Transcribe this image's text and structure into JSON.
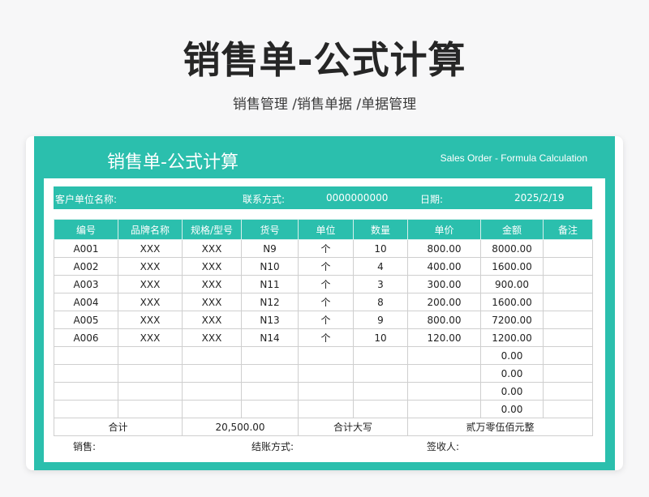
{
  "page": {
    "title": "销售单-公式计算",
    "breadcrumb": "销售管理 /销售单据 /单据管理"
  },
  "sheet": {
    "title": "销售单-公式计算",
    "subtitle": "Sales Order - Formula Calculation",
    "accent_color": "#2bbfad"
  },
  "info": {
    "customer_label": "客户单位名称:",
    "contact_label": "联系方式:",
    "contact_value": "0000000000",
    "date_label": "日期:",
    "date_value": "2025/2/19"
  },
  "table": {
    "headers": [
      "编号",
      "品牌名称",
      "规格/型号",
      "货号",
      "单位",
      "数量",
      "单价",
      "金额",
      "备注"
    ],
    "rows": [
      [
        "A001",
        "XXX",
        "XXX",
        "N9",
        "个",
        "10",
        "800.00",
        "8000.00",
        ""
      ],
      [
        "A002",
        "XXX",
        "XXX",
        "N10",
        "个",
        "4",
        "400.00",
        "1600.00",
        ""
      ],
      [
        "A003",
        "XXX",
        "XXX",
        "N11",
        "个",
        "3",
        "300.00",
        "900.00",
        ""
      ],
      [
        "A004",
        "XXX",
        "XXX",
        "N12",
        "个",
        "8",
        "200.00",
        "1600.00",
        ""
      ],
      [
        "A005",
        "XXX",
        "XXX",
        "N13",
        "个",
        "9",
        "800.00",
        "7200.00",
        ""
      ],
      [
        "A006",
        "XXX",
        "XXX",
        "N14",
        "个",
        "10",
        "120.00",
        "1200.00",
        ""
      ],
      [
        "",
        "",
        "",
        "",
        "",
        "",
        "",
        "0.00",
        ""
      ],
      [
        "",
        "",
        "",
        "",
        "",
        "",
        "",
        "0.00",
        ""
      ],
      [
        "",
        "",
        "",
        "",
        "",
        "",
        "",
        "0.00",
        ""
      ],
      [
        "",
        "",
        "",
        "",
        "",
        "",
        "",
        "0.00",
        ""
      ]
    ],
    "total": {
      "label": "合计",
      "value": "20,500.00",
      "capital_label": "合计大写",
      "capital_value": "贰万零伍佰元整"
    }
  },
  "footer": {
    "sales_label": "销售:",
    "settlement_label": "结账方式:",
    "receiver_label": "签收人:"
  }
}
